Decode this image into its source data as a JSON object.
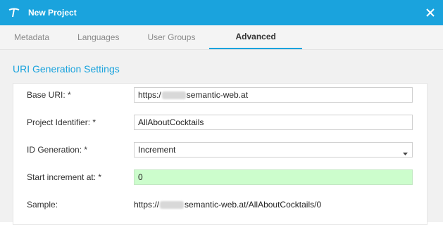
{
  "dialog": {
    "title": "New Project",
    "close_icon": "close-icon",
    "logo_icon": "app-logo-icon"
  },
  "tabs": [
    {
      "label": "Metadata",
      "active": false
    },
    {
      "label": "Languages",
      "active": false
    },
    {
      "label": "User Groups",
      "active": false
    },
    {
      "label": "Advanced",
      "active": true
    }
  ],
  "section": {
    "title": "URI Generation Settings"
  },
  "form": {
    "base_uri": {
      "label": "Base URI: *",
      "prefix": "https:/",
      "suffix": "semantic-web.at"
    },
    "project_identifier": {
      "label": "Project Identifier: *",
      "value": "AllAboutCocktails"
    },
    "id_generation": {
      "label": "ID Generation: *",
      "value": "Increment"
    },
    "start_increment": {
      "label": "Start increment at: *",
      "value": "0"
    },
    "sample": {
      "label": "Sample:",
      "prefix": "https://",
      "suffix": "semantic-web.at/AllAboutCocktails/0"
    }
  },
  "colors": {
    "accent": "#1aa3dd",
    "highlight_field": "#ccfdcc"
  }
}
